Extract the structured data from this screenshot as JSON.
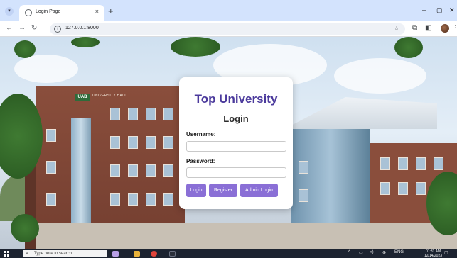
{
  "browser": {
    "tab_title": "Login Page",
    "tab_close": "×",
    "new_tab": "+",
    "minimize": "–",
    "maximize": "▢",
    "close": "✕",
    "url": "127.0.0.1:8000",
    "back": "←",
    "forward": "→",
    "reload": "↻",
    "icons": [
      "star-icon",
      "extensions-icon",
      "sidebar-icon",
      "profile-icon",
      "menu-icon"
    ]
  },
  "login": {
    "brand": "Top University",
    "heading": "Login",
    "username_label": "Username:",
    "username_value": "",
    "password_label": "Password:",
    "password_value": "",
    "buttons": {
      "login": "Login",
      "register": "Register",
      "admin_login": "Admin Login"
    },
    "accent_color": "#8a6fd6",
    "brand_color": "#4b3a9c"
  },
  "scene": {
    "sign_logo": "UAB",
    "sign_text": "UNIVERSITY HALL"
  },
  "taskbar": {
    "search_placeholder": "Type here to search",
    "language": "ENG",
    "time": "01:31 AM",
    "date": "12/14/2023"
  }
}
